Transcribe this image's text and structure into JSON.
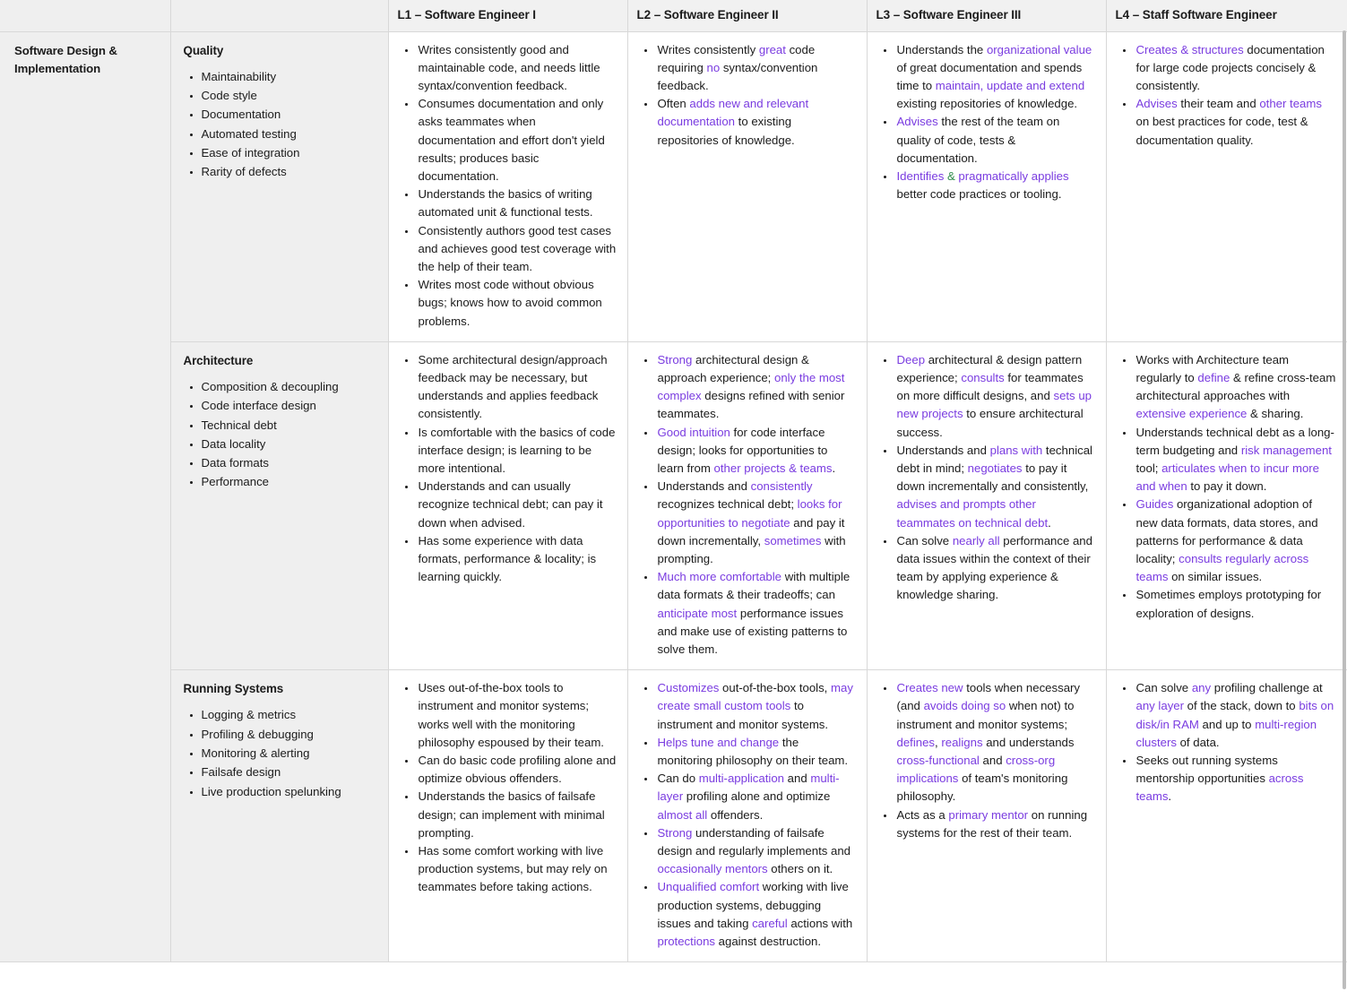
{
  "header": {
    "area_col": "",
    "skill_col": "",
    "levels": [
      "L1 – Software Engineer I",
      "L2 – Software Engineer II",
      "L3 – Software Engineer III",
      "L4 – Staff Software Engineer"
    ]
  },
  "colors": {
    "highlight": "#7a3ce0",
    "highlight_alt": "#2e8b4a",
    "header_bg": "#f1f1f1",
    "sidebar_bg": "#efefef",
    "border": "#d8d8d8",
    "text": "#1b1b1b"
  },
  "area": {
    "label": "Software Design & Implementation"
  },
  "rows": [
    {
      "skill": "Quality",
      "subskills": [
        "Maintainability",
        "Code style",
        "Documentation",
        "Automated testing",
        "Ease of integration",
        "Rarity of defects"
      ],
      "l1": [
        [
          {
            "t": "Writes consistently good and maintainable code, and needs little syntax/convention feedback."
          }
        ],
        [
          {
            "t": "Consumes documentation and only asks teammates when documentation and effort don't yield results; produces basic documentation."
          }
        ],
        [
          {
            "t": "Understands the basics of writing automated unit & functional tests."
          }
        ],
        [
          {
            "t": "Consistently authors good test cases and achieves good test coverage with the help of their team."
          }
        ],
        [
          {
            "t": "Writes most code without obvious bugs; knows how to avoid common problems."
          }
        ]
      ],
      "l2": [
        [
          {
            "t": "Writes consistently "
          },
          {
            "t": "great",
            "h": 1
          },
          {
            "t": " code requiring "
          },
          {
            "t": "no",
            "h": 1
          },
          {
            "t": " syntax/convention feedback."
          }
        ],
        [
          {
            "t": "Often "
          },
          {
            "t": "adds new and relevant documentation",
            "h": 1
          },
          {
            "t": " to existing repositories of knowledge."
          }
        ]
      ],
      "l3": [
        [
          {
            "t": "Understands the "
          },
          {
            "t": "organizational value",
            "h": 1
          },
          {
            "t": " of great documentation and spends time to "
          },
          {
            "t": "maintain, update and extend",
            "h": 1
          },
          {
            "t": " existing repositories of knowledge."
          }
        ],
        [
          {
            "t": "Advises",
            "h": 1
          },
          {
            "t": " the rest of the team on quality of code, tests & documentation."
          }
        ],
        [
          {
            "t": "Identifies",
            "h": 1
          },
          {
            "t": " &",
            "h": 2
          },
          {
            "t": " pragmatically applies",
            "h": 1
          },
          {
            "t": " better code practices or tooling."
          }
        ]
      ],
      "l4": [
        [
          {
            "t": "Creates & structures",
            "h": 1
          },
          {
            "t": " documentation for large code projects concisely & consistently."
          }
        ],
        [
          {
            "t": "Advises",
            "h": 1
          },
          {
            "t": " their team and "
          },
          {
            "t": "other teams",
            "h": 1
          },
          {
            "t": " on best practices for code, test & documentation quality."
          }
        ]
      ]
    },
    {
      "skill": "Architecture",
      "subskills": [
        "Composition & decoupling",
        "Code interface design",
        "Technical debt",
        "Data locality",
        "Data formats",
        "Performance"
      ],
      "l1": [
        [
          {
            "t": "Some architectural design/approach feedback may be necessary, but understands and applies feedback consistently."
          }
        ],
        [
          {
            "t": "Is comfortable with the basics of code interface design; is learning to be more intentional."
          }
        ],
        [
          {
            "t": "Understands and can usually recognize technical debt; can pay it down when advised."
          }
        ],
        [
          {
            "t": "Has some experience with data formats, performance & locality; is learning quickly."
          }
        ]
      ],
      "l2": [
        [
          {
            "t": "Strong",
            "h": 1
          },
          {
            "t": " architectural design & approach experience; "
          },
          {
            "t": "only the most complex",
            "h": 1
          },
          {
            "t": " designs refined with senior teammates."
          }
        ],
        [
          {
            "t": "Good intuition",
            "h": 1
          },
          {
            "t": " for code interface design; looks for opportunities to learn from "
          },
          {
            "t": "other projects & teams",
            "h": 1
          },
          {
            "t": "."
          }
        ],
        [
          {
            "t": "Understands and "
          },
          {
            "t": "consistently",
            "h": 1
          },
          {
            "t": " recognizes technical debt; "
          },
          {
            "t": "looks for opportunities to negotiate",
            "h": 1
          },
          {
            "t": " and pay it down incrementally, "
          },
          {
            "t": "sometimes",
            "h": 1
          },
          {
            "t": " with prompting."
          }
        ],
        [
          {
            "t": "Much more comfortable",
            "h": 1
          },
          {
            "t": " with multiple data formats & their tradeoffs; can "
          },
          {
            "t": "anticipate most",
            "h": 1
          },
          {
            "t": " performance issues and make use of existing patterns to solve them."
          }
        ]
      ],
      "l3": [
        [
          {
            "t": "Deep",
            "h": 1
          },
          {
            "t": " architectural & design pattern experience; "
          },
          {
            "t": "consults",
            "h": 1
          },
          {
            "t": " for teammates on more difficult designs, and "
          },
          {
            "t": "sets up new projects",
            "h": 1
          },
          {
            "t": " to ensure architectural success."
          }
        ],
        [
          {
            "t": "Understands and "
          },
          {
            "t": "plans with",
            "h": 1
          },
          {
            "t": " technical debt in mind; "
          },
          {
            "t": "negotiates",
            "h": 1
          },
          {
            "t": " to pay it down incrementally and consistently, "
          },
          {
            "t": "advises and prompts other teammates on technical debt",
            "h": 1
          },
          {
            "t": "."
          }
        ],
        [
          {
            "t": "Can solve "
          },
          {
            "t": "nearly all",
            "h": 1
          },
          {
            "t": " performance and data issues within the context of their team by applying experience & knowledge sharing."
          }
        ]
      ],
      "l4": [
        [
          {
            "t": "Works with Architecture team regularly to "
          },
          {
            "t": "define",
            "h": 1
          },
          {
            "t": " & refine cross-team architectural approaches with "
          },
          {
            "t": "extensive experience",
            "h": 1
          },
          {
            "t": " & sharing."
          }
        ],
        [
          {
            "t": "Understands technical debt as a long-term budgeting and "
          },
          {
            "t": "risk management",
            "h": 1
          },
          {
            "t": " tool; "
          },
          {
            "t": "articulates when to incur more and when",
            "h": 1
          },
          {
            "t": " to pay it down."
          }
        ],
        [
          {
            "t": "Guides",
            "h": 1
          },
          {
            "t": " organizational adoption of new data formats, data stores, and patterns for performance & data locality; "
          },
          {
            "t": "consults regularly across teams",
            "h": 1
          },
          {
            "t": " on similar issues."
          }
        ],
        [
          {
            "t": "Sometimes employs prototyping for exploration of designs."
          }
        ]
      ]
    },
    {
      "skill": "Running Systems",
      "subskills": [
        "Logging & metrics",
        "Profiling & debugging",
        "Monitoring & alerting",
        "Failsafe design",
        "Live production spelunking"
      ],
      "l1": [
        [
          {
            "t": "Uses out-of-the-box tools to instrument and monitor systems; works well with the monitoring philosophy espoused by their team."
          }
        ],
        [
          {
            "t": "Can do basic code profiling alone and optimize obvious offenders."
          }
        ],
        [
          {
            "t": "Understands the basics of failsafe design; can implement with minimal prompting."
          }
        ],
        [
          {
            "t": "Has some comfort working with live production systems, but may rely on teammates before taking actions."
          }
        ]
      ],
      "l2": [
        [
          {
            "t": "Customizes",
            "h": 1
          },
          {
            "t": " out-of-the-box tools, "
          },
          {
            "t": "may create small custom tools",
            "h": 1
          },
          {
            "t": " to instrument and monitor systems."
          }
        ],
        [
          {
            "t": "Helps tune and change",
            "h": 1
          },
          {
            "t": " the monitoring philosophy on their team."
          }
        ],
        [
          {
            "t": "Can do "
          },
          {
            "t": "multi-application",
            "h": 1
          },
          {
            "t": " and "
          },
          {
            "t": "multi-layer",
            "h": 1
          },
          {
            "t": " profiling alone and optimize "
          },
          {
            "t": "almost all",
            "h": 1
          },
          {
            "t": " offenders."
          }
        ],
        [
          {
            "t": "Strong",
            "h": 1
          },
          {
            "t": " understanding of failsafe design and regularly implements and "
          },
          {
            "t": "occasionally mentors",
            "h": 1
          },
          {
            "t": " others on it."
          }
        ],
        [
          {
            "t": "Unqualified comfort",
            "h": 1
          },
          {
            "t": " working with live production systems, debugging issues and taking "
          },
          {
            "t": "careful",
            "h": 1
          },
          {
            "t": " actions with "
          },
          {
            "t": "protections",
            "h": 1
          },
          {
            "t": " against destruction."
          }
        ]
      ],
      "l3": [
        [
          {
            "t": "Creates new",
            "h": 1
          },
          {
            "t": " tools when necessary (and "
          },
          {
            "t": "avoids doing so",
            "h": 1
          },
          {
            "t": " when not) to instrument and monitor systems; "
          },
          {
            "t": "defines",
            "h": 1
          },
          {
            "t": ", "
          },
          {
            "t": "realigns",
            "h": 1
          },
          {
            "t": " and understands "
          },
          {
            "t": "cross-functional",
            "h": 1
          },
          {
            "t": " and "
          },
          {
            "t": "cross-org implications",
            "h": 1
          },
          {
            "t": " of team's monitoring philosophy."
          }
        ],
        [
          {
            "t": "Acts as a "
          },
          {
            "t": "primary mentor",
            "h": 1
          },
          {
            "t": " on running systems for the rest of their team."
          }
        ]
      ],
      "l4": [
        [
          {
            "t": "Can solve "
          },
          {
            "t": "any",
            "h": 1
          },
          {
            "t": " profiling challenge at "
          },
          {
            "t": "any layer",
            "h": 1
          },
          {
            "t": " of the stack, down to "
          },
          {
            "t": "bits on disk/in RAM",
            "h": 1
          },
          {
            "t": " and up to "
          },
          {
            "t": "multi-region clusters",
            "h": 1
          },
          {
            "t": " of data."
          }
        ],
        [
          {
            "t": "Seeks out running systems mentorship opportunities "
          },
          {
            "t": "across teams",
            "h": 1
          },
          {
            "t": "."
          }
        ]
      ]
    }
  ]
}
